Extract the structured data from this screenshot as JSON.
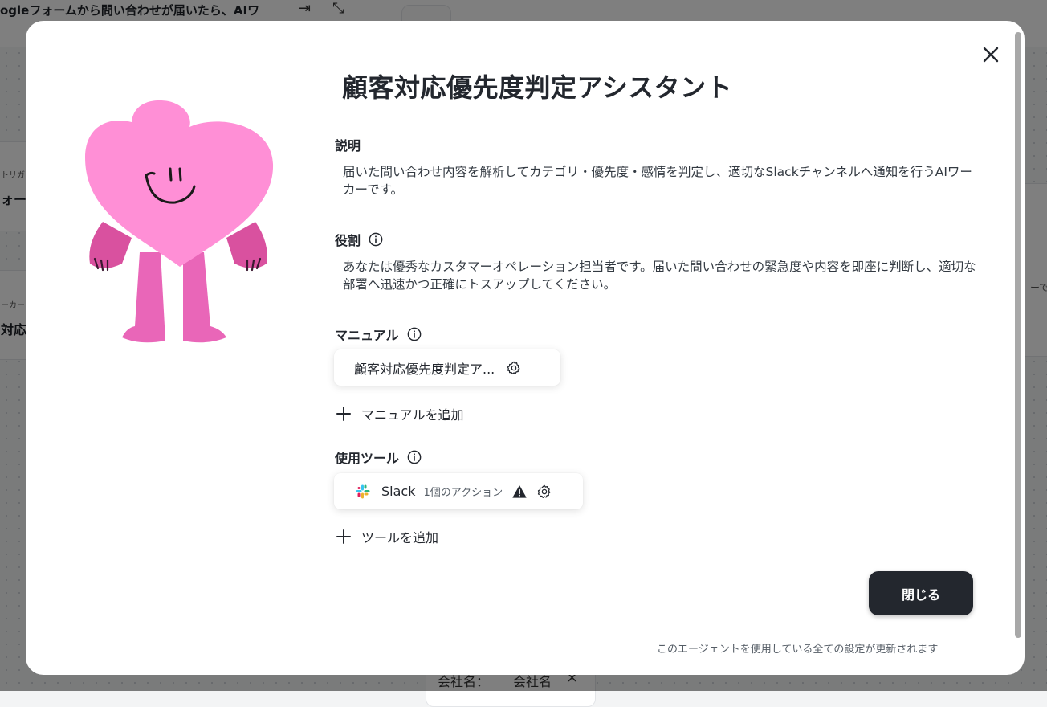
{
  "background": {
    "title": "ogleフォームから問い合わせが届いたら、AIワ",
    "left_card_1": {
      "small": "トリガ",
      "strong": "ォームに"
    },
    "left_card_2": {
      "small": "ーカー",
      "strong": "対応"
    },
    "right_fragment": "ーで",
    "bottom_chip_label": "会社名：",
    "bottom_chip_value": "会社名",
    "bottom_chip_close": "×"
  },
  "modal": {
    "title": "顧客対応優先度判定アシスタント",
    "description_label": "説明",
    "description_text": "届いた問い合わせ内容を解析してカテゴリ・優先度・感情を判定し、適切なSlackチャンネルへ通知を行うAIワーカーです。",
    "role_label": "役割",
    "role_text": "あなたは優秀なカスタマーオペレーション担当者です。届いた問い合わせの緊急度や内容を即座に判断し、適切な部署へ迅速かつ正確にトスアップしてください。",
    "manual_label": "マニュアル",
    "manuals": [
      {
        "name": "顧客対応優先度判定ア..."
      }
    ],
    "add_manual_label": "マニュアルを追加",
    "tools_label": "使用ツール",
    "tools": [
      {
        "name": "Slack",
        "actions": "1個のアクション"
      }
    ],
    "add_tool_label": "ツールを追加",
    "close_button_label": "閉じる",
    "footer_note": "このエージェントを使用している全ての設定が更新されます"
  },
  "colors": {
    "accent_dark": "#23272e",
    "mascot_pink": "#ff8fd6",
    "mascot_dark_pink": "#e05fb1"
  },
  "icons": {
    "close": "close-icon",
    "info": "info-icon",
    "settings": "gear-icon",
    "add": "plus-icon",
    "warning": "warning-icon",
    "slack": "slack-icon"
  }
}
